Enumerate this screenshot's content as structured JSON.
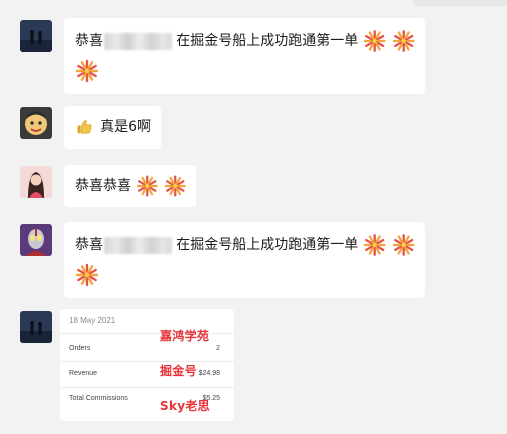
{
  "messages": [
    {
      "avatar": "avatar-dark-silhouettes",
      "prefix": "恭喜",
      "text": "在掘金号船上成功跑通第一单"
    },
    {
      "avatar": "avatar-cartoon-face",
      "text": "真是6啊",
      "emoji": "thumbs-up"
    },
    {
      "avatar": "avatar-woman-portrait",
      "text": "恭喜恭喜"
    },
    {
      "avatar": "avatar-ultraman",
      "prefix": "恭喜",
      "text": "在掘金号船上成功跑通第一单"
    }
  ],
  "image_card": {
    "date": "18 May 2021",
    "rows": [
      {
        "label": "Orders",
        "value": "2"
      },
      {
        "label": "Revenue",
        "value": "$24.98"
      },
      {
        "label": "Total Commissions",
        "value": "$5.25"
      }
    ],
    "watermark": [
      "嘉鸿学苑",
      "掘金号",
      "Sky老思"
    ]
  },
  "colors": {
    "background": "#f2f2f2",
    "bubble": "#ffffff",
    "watermark": "#e8333b"
  }
}
